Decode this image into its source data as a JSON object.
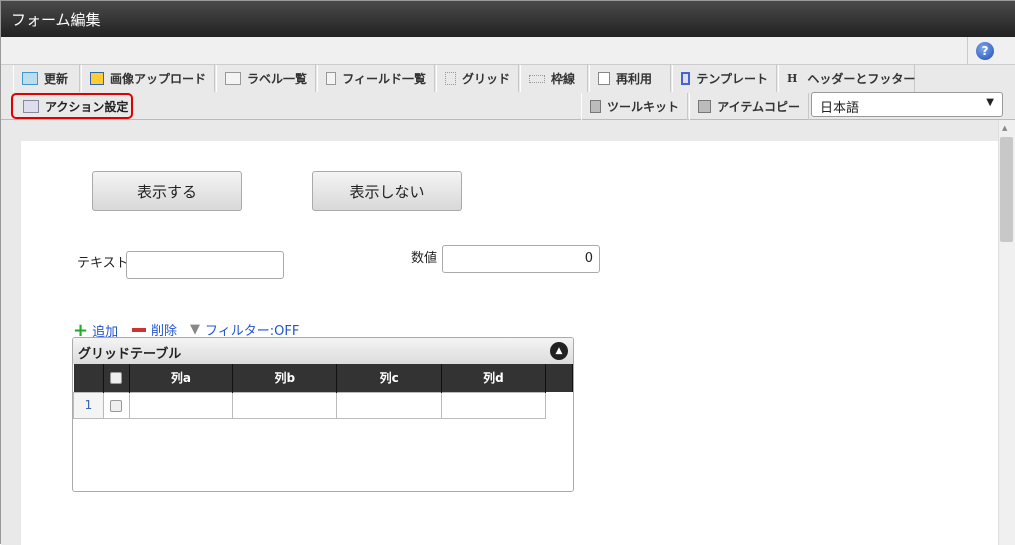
{
  "title": "フォーム編集",
  "help_icon": "?",
  "tabs": [
    {
      "label": "更新",
      "icon": "update-icon"
    },
    {
      "label": "画像アップロード",
      "icon": "image-upload-icon"
    },
    {
      "label": "ラベル一覧",
      "icon": "list-icon"
    },
    {
      "label": "フィールド一覧",
      "icon": "list-icon"
    },
    {
      "label": "グリッド",
      "icon": "grid-icon"
    },
    {
      "label": "枠線",
      "icon": "border-icon"
    },
    {
      "label": "再利用",
      "icon": "copy-icon"
    },
    {
      "label": "テンプレート",
      "icon": "template-icon"
    },
    {
      "label": "ヘッダーとフッター",
      "icon": "header-icon"
    }
  ],
  "row2": {
    "action": "アクション設定",
    "toolkit": "ツールキット",
    "itemcopy": "アイテムコピー",
    "language": "日本語"
  },
  "form": {
    "show_button": "表示する",
    "hide_button": "表示しない",
    "text_label": "テキスト",
    "text_value": "",
    "number_label": "数値",
    "number_value": "0",
    "add": "追加",
    "delete": "削除",
    "filter": "フィルター:OFF",
    "grid_title": "グリッドテーブル",
    "columns": [
      "列a",
      "列b",
      "列c",
      "列d"
    ],
    "rows": [
      {
        "num": "1"
      }
    ]
  }
}
